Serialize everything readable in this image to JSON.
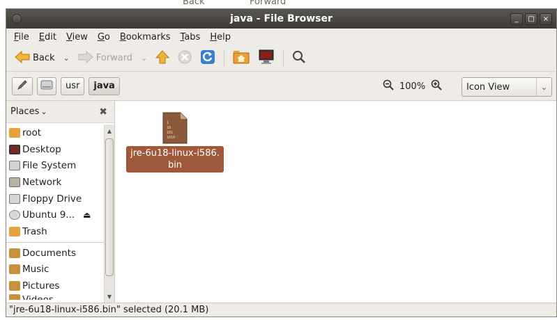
{
  "window": {
    "title": "java - File Browser",
    "minimize_label": "_",
    "maximize_label": "□",
    "close_label": "×"
  },
  "background_window": {
    "back_label": "Back",
    "forward_label": "Forward"
  },
  "menu": [
    {
      "key": "F",
      "rest": "ile"
    },
    {
      "key": "E",
      "rest": "dit"
    },
    {
      "key": "V",
      "rest": "iew"
    },
    {
      "key": "G",
      "rest": "o"
    },
    {
      "key": "B",
      "rest": "ookmarks"
    },
    {
      "key": "T",
      "rest": "abs"
    },
    {
      "key": "H",
      "rest": "elp"
    }
  ],
  "toolbar": {
    "back_label": "Back",
    "forward_label": "Forward"
  },
  "location": {
    "crumbs": [
      "usr",
      "java"
    ],
    "zoom_level": "100%",
    "view_mode": "Icon View"
  },
  "sidebar": {
    "header": "Places",
    "places": [
      {
        "label": "root",
        "icon": "home-folder-icon",
        "color": "#e8a03a"
      },
      {
        "label": "Desktop",
        "icon": "desktop-icon",
        "color": "#7a2a22"
      },
      {
        "label": "File System",
        "icon": "harddisk-icon",
        "color": "#9aa0a8"
      },
      {
        "label": "Network",
        "icon": "network-icon",
        "color": "#a49c90"
      },
      {
        "label": "Floppy Drive",
        "icon": "floppy-icon",
        "color": "#b8b4ae"
      },
      {
        "label": "Ubuntu 9...",
        "icon": "cdrom-icon",
        "color": "#c9c9c9"
      },
      {
        "label": "Trash",
        "icon": "trash-icon",
        "color": "#e8a040"
      }
    ],
    "bookmarks": [
      {
        "label": "Documents",
        "icon": "documents-folder-icon",
        "color": "#c9913a"
      },
      {
        "label": "Music",
        "icon": "music-folder-icon",
        "color": "#c9913a"
      },
      {
        "label": "Pictures",
        "icon": "pictures-folder-icon",
        "color": "#c9913a"
      },
      {
        "label": "Videos",
        "icon": "videos-folder-icon",
        "color": "#c9913a"
      }
    ]
  },
  "files": [
    {
      "name": "jre-6u18-linux-i586.bin",
      "icon": "binary-file-icon",
      "selected": true,
      "icon_text": "1\n10\n101\n1010"
    }
  ],
  "status": "\"jre-6u18-linux-i586.bin\" selected (20.1 MB)"
}
